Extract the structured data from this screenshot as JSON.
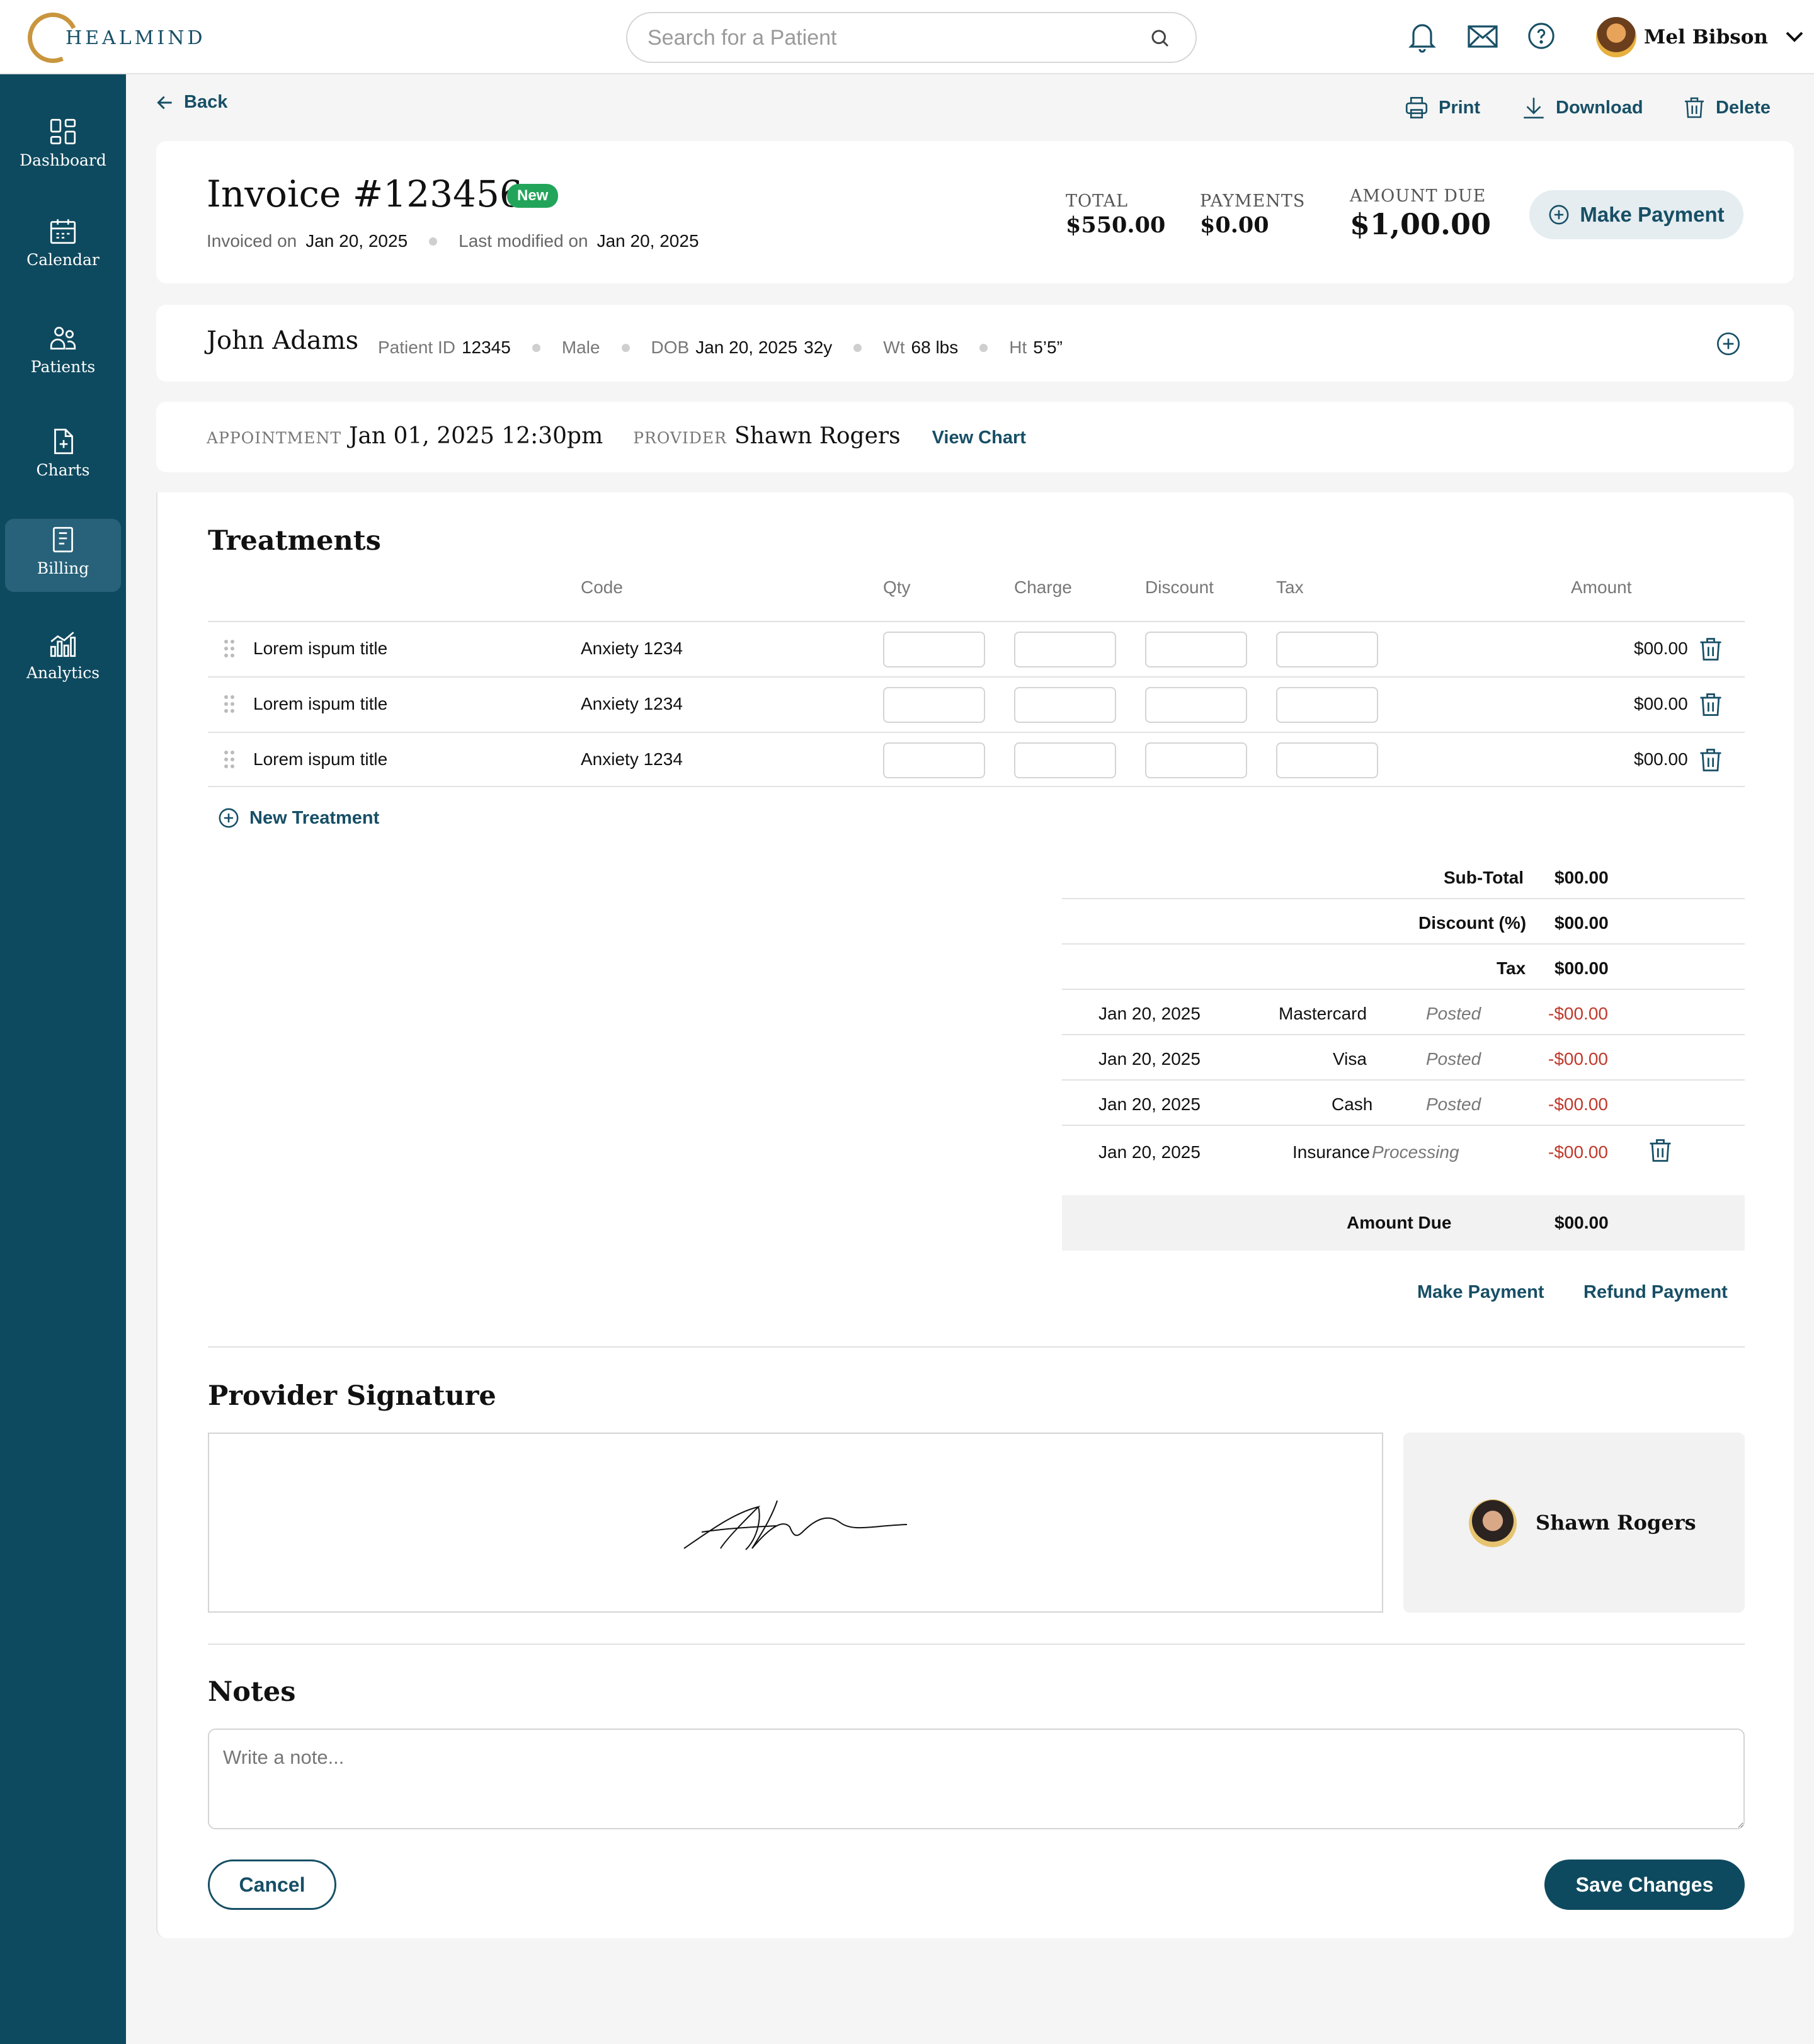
{
  "app": {
    "logo_text": "HEALMIND"
  },
  "search": {
    "placeholder": "Search for a Patient"
  },
  "user": {
    "name": "Mel Bibson"
  },
  "sidebar": {
    "items": [
      {
        "label": "Dashboard",
        "icon": "dashboard-icon"
      },
      {
        "label": "Calendar",
        "icon": "calendar-icon"
      },
      {
        "label": "Patients",
        "icon": "patients-icon"
      },
      {
        "label": "Charts",
        "icon": "charts-icon"
      },
      {
        "label": "Billing",
        "icon": "billing-icon",
        "active": true
      },
      {
        "label": "Analytics",
        "icon": "analytics-icon"
      }
    ]
  },
  "actions": {
    "back": "Back",
    "print": "Print",
    "download": "Download",
    "delete": "Delete"
  },
  "invoice": {
    "title": "Invoice #123456",
    "badge": "New",
    "invoiced_label": "Invoiced on",
    "invoiced_date": "Jan 20, 2025",
    "modified_label": "Last modified on",
    "modified_date": "Jan 20, 2025",
    "total_label": "TOTAL",
    "total_value": "$550.00",
    "payments_label": "PAYMENTS",
    "payments_value": "$0.00",
    "due_label": "AMOUNT DUE",
    "due_value": "$1,00.00",
    "make_payment": "Make Payment"
  },
  "patient": {
    "name": "John Adams",
    "id_label": "Patient ID",
    "id": "12345",
    "sex": "Male",
    "dob_label": "DOB",
    "dob": "Jan 20, 2025",
    "age": "32y",
    "wt_label": "Wt",
    "wt": "68 lbs",
    "ht_label": "Ht",
    "ht": "5’5”"
  },
  "appointment": {
    "label": "APPOINTMENT",
    "value": "Jan 01, 2025 12:30pm",
    "provider_label": "PROVIDER",
    "provider": "Shawn Rogers",
    "view_chart": "View Chart"
  },
  "treatments": {
    "title": "Treatments",
    "columns": {
      "code": "Code",
      "qty": "Qty",
      "charge": "Charge",
      "discount": "Discount",
      "tax": "Tax",
      "amount": "Amount"
    },
    "rows": [
      {
        "title": "Lorem ispum title",
        "code": "Anxiety 1234",
        "amount": "$00.00"
      },
      {
        "title": "Lorem ispum title",
        "code": "Anxiety 1234",
        "amount": "$00.00"
      },
      {
        "title": "Lorem ispum title",
        "code": "Anxiety 1234",
        "amount": "$00.00"
      }
    ],
    "new_treatment": "New Treatment"
  },
  "totals": {
    "subtotal_label": "Sub-Total",
    "subtotal": "$00.00",
    "discount_label": "Discount (%)",
    "discount": "$00.00",
    "tax_label": "Tax",
    "tax": "$00.00",
    "payments": [
      {
        "date": "Jan 20, 2025",
        "method": "Mastercard",
        "status": "Posted",
        "amount": "-$00.00"
      },
      {
        "date": "Jan 20, 2025",
        "method": "Visa",
        "status": "Posted",
        "amount": "-$00.00"
      },
      {
        "date": "Jan 20, 2025",
        "method": "Cash",
        "status": "Posted",
        "amount": "-$00.00"
      },
      {
        "date": "Jan 20, 2025",
        "method": "Insurance",
        "status": "Processing",
        "amount": "-$00.00"
      }
    ],
    "amount_due_label": "Amount Due",
    "amount_due": "$00.00",
    "make_payment": "Make Payment",
    "refund_payment": "Refund Payment"
  },
  "signature": {
    "title": "Provider Signature",
    "provider": "Shawn Rogers"
  },
  "notes": {
    "title": "Notes",
    "placeholder": "Write a note..."
  },
  "footer": {
    "cancel": "Cancel",
    "save": "Save Changes"
  },
  "colors": {
    "primary": "#0e4a5f",
    "accent_gold": "#c9963e",
    "badge_green": "#22a55a",
    "negative": "#c0392b"
  }
}
